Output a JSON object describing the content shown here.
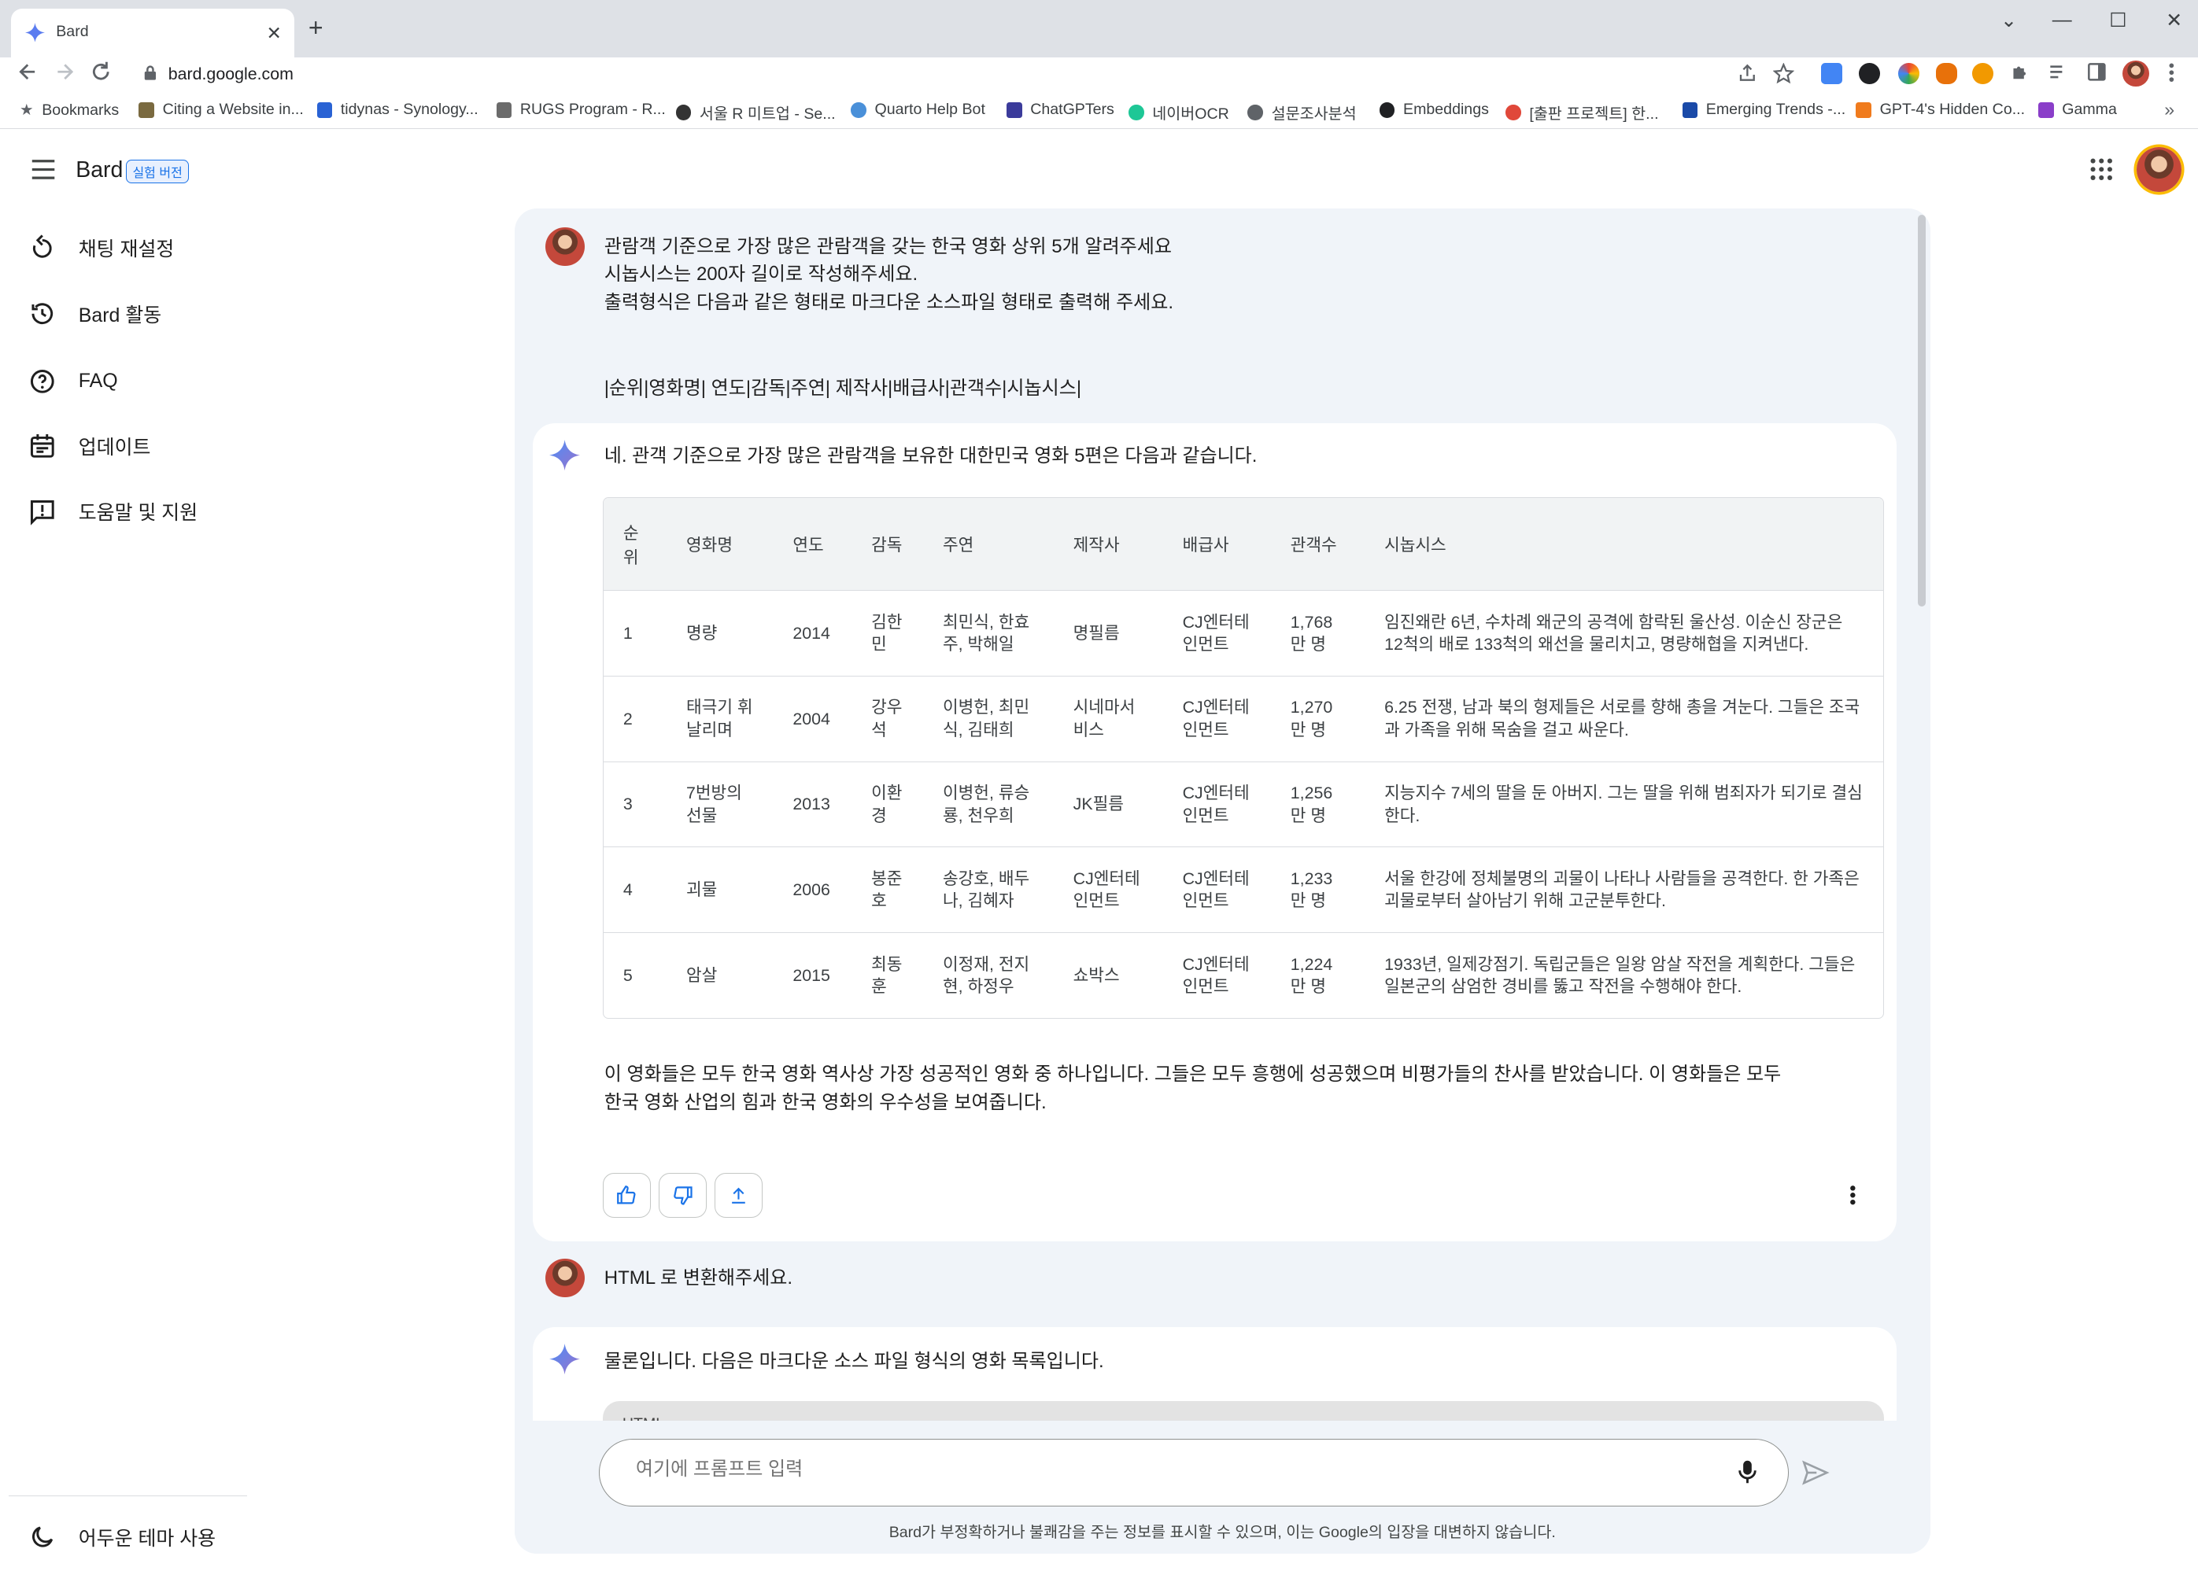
{
  "browser": {
    "tab_title": "Bard",
    "tab_close": "✕",
    "new_tab": "+",
    "url": "bard.google.com",
    "win_min": "—",
    "win_max": "☐",
    "win_close": "✕",
    "tab_search": "⌄",
    "more_bookmarks": "»",
    "bookmarks": [
      {
        "label": "Bookmarks",
        "icon": "star-icon",
        "color": "#5f6368"
      },
      {
        "label": "Citing a Website in...",
        "icon": "y-icon",
        "color": "#7a6a40"
      },
      {
        "label": "tidynas - Synology...",
        "icon": "dsm-icon",
        "color": "#2962d4"
      },
      {
        "label": "RUGS Program - R...",
        "icon": "r-icon",
        "color": "#6b6b6b"
      },
      {
        "label": "서울 R 미트업 - Se...",
        "icon": "meetup-icon",
        "color": "#333333"
      },
      {
        "label": "Quarto Help Bot",
        "icon": "globe-icon",
        "color": "#4a90d9"
      },
      {
        "label": "ChatGPTers",
        "icon": "chatgpters-icon",
        "color": "#3b3b9b"
      },
      {
        "label": "네이버OCR",
        "icon": "ocr-icon",
        "color": "#1ec796"
      },
      {
        "label": "설문조사분석",
        "icon": "globe-icon",
        "color": "#5f6368"
      },
      {
        "label": "Embeddings",
        "icon": "openai-icon",
        "color": "#202124"
      },
      {
        "label": "[출판 프로젝트] 한...",
        "icon": "project-icon",
        "color": "#e0483a"
      },
      {
        "label": "Emerging Trends -...",
        "icon": "square-icon",
        "color": "#1a4aa8"
      },
      {
        "label": "GPT-4's Hidden Co...",
        "icon": "rss-icon",
        "color": "#f07b1d"
      },
      {
        "label": "Gamma",
        "icon": "gamma-icon",
        "color": "#8a3ec9"
      }
    ]
  },
  "app": {
    "name": "Bard",
    "badge": "실험 버전"
  },
  "sidebar": {
    "items": [
      {
        "label": "채팅 재설정",
        "icon": "reset-icon"
      },
      {
        "label": "Bard 활동",
        "icon": "history-icon"
      },
      {
        "label": "FAQ",
        "icon": "help-circle-icon"
      },
      {
        "label": "업데이트",
        "icon": "calendar-icon"
      },
      {
        "label": "도움말 및 지원",
        "icon": "feedback-icon"
      }
    ],
    "dark_theme": "어두운 테마 사용"
  },
  "chat": {
    "user_prompt_1": [
      "관람객 기준으로 가장 많은 관람객을 갖는 한국 영화 상위 5개 알려주세요",
      "시놉시스는 200자 길이로 작성해주세요.",
      "출력형식은 다음과 같은 형태로 마크다운 소스파일 형태로 출력해 주세요."
    ],
    "user_prompt_1_format": "|순위|영화명| 연도|감독|주연| 제작사|배급사|관객수|시놉시스|",
    "response_1_intro": "네. 관객 기준으로 가장 많은 관람객을 보유한 대한민국 영화 5편은 다음과 같습니다.",
    "table": {
      "headers": [
        "순위",
        "영화명",
        "연도",
        "감독",
        "주연",
        "제작사",
        "배급사",
        "관객수",
        "시놉시스"
      ],
      "rows": [
        [
          "1",
          "명량",
          "2014",
          "김한민",
          "최민식, 한효주, 박해일",
          "명필름",
          "CJ엔터테인먼트",
          "1,768만 명",
          "임진왜란 6년, 수차례 왜군의 공격에 함락된 울산성. 이순신 장군은 12척의 배로 133척의 왜선을 물리치고, 명량해협을 지켜낸다."
        ],
        [
          "2",
          "태극기 휘날리며",
          "2004",
          "강우석",
          "이병헌, 최민식, 김태희",
          "시네마서비스",
          "CJ엔터테인먼트",
          "1,270만 명",
          "6.25 전쟁, 남과 북의 형제들은 서로를 향해 총을 겨눈다. 그들은 조국과 가족을 위해 목숨을 걸고 싸운다."
        ],
        [
          "3",
          "7번방의 선물",
          "2013",
          "이환경",
          "이병헌, 류승룡, 천우희",
          "JK필름",
          "CJ엔터테인먼트",
          "1,256만 명",
          "지능지수 7세의 딸을 둔 아버지. 그는 딸을 위해 범죄자가 되기로 결심한다."
        ],
        [
          "4",
          "괴물",
          "2006",
          "봉준호",
          "송강호, 배두나, 김혜자",
          "CJ엔터테인먼트",
          "CJ엔터테인먼트",
          "1,233만 명",
          "서울 한강에 정체불명의 괴물이 나타나 사람들을 공격한다. 한 가족은 괴물로부터 살아남기 위해 고군분투한다."
        ],
        [
          "5",
          "암살",
          "2015",
          "최동훈",
          "이정재, 전지현, 하정우",
          "쇼박스",
          "CJ엔터테인먼트",
          "1,224만 명",
          "1933년, 일제강점기. 독립군들은 일왕 암살 작전을 계획한다. 그들은 일본군의 삼엄한 경비를 뚫고 작전을 수행해야 한다."
        ]
      ]
    },
    "response_1_outro": [
      "이 영화들은 모두 한국 영화 역사상 가장 성공적인 영화 중 하나입니다. 그들은 모두 흥행에 성공했으며 비평가들의 찬사를 받았습니다. 이 영화들은 모두",
      "한국 영화 산업의 힘과 한국 영화의 우수성을 보여줍니다."
    ],
    "user_prompt_2": "HTML 로 변환해주세요.",
    "response_2_intro": "물론입니다. 다음은 마크다운 소스 파일 형식의 영화 목록입니다.",
    "code_block_label": "HTML"
  },
  "input": {
    "placeholder": "여기에 프롬프트 입력"
  },
  "disclaimer": "Bard가 부정확하거나 불쾌감을 주는 정보를 표시할 수 있으며, 이는 Google의 입장을 대변하지 않습니다.",
  "colors": {
    "accent": "#1a73e8",
    "background": "#f0f4f9"
  }
}
